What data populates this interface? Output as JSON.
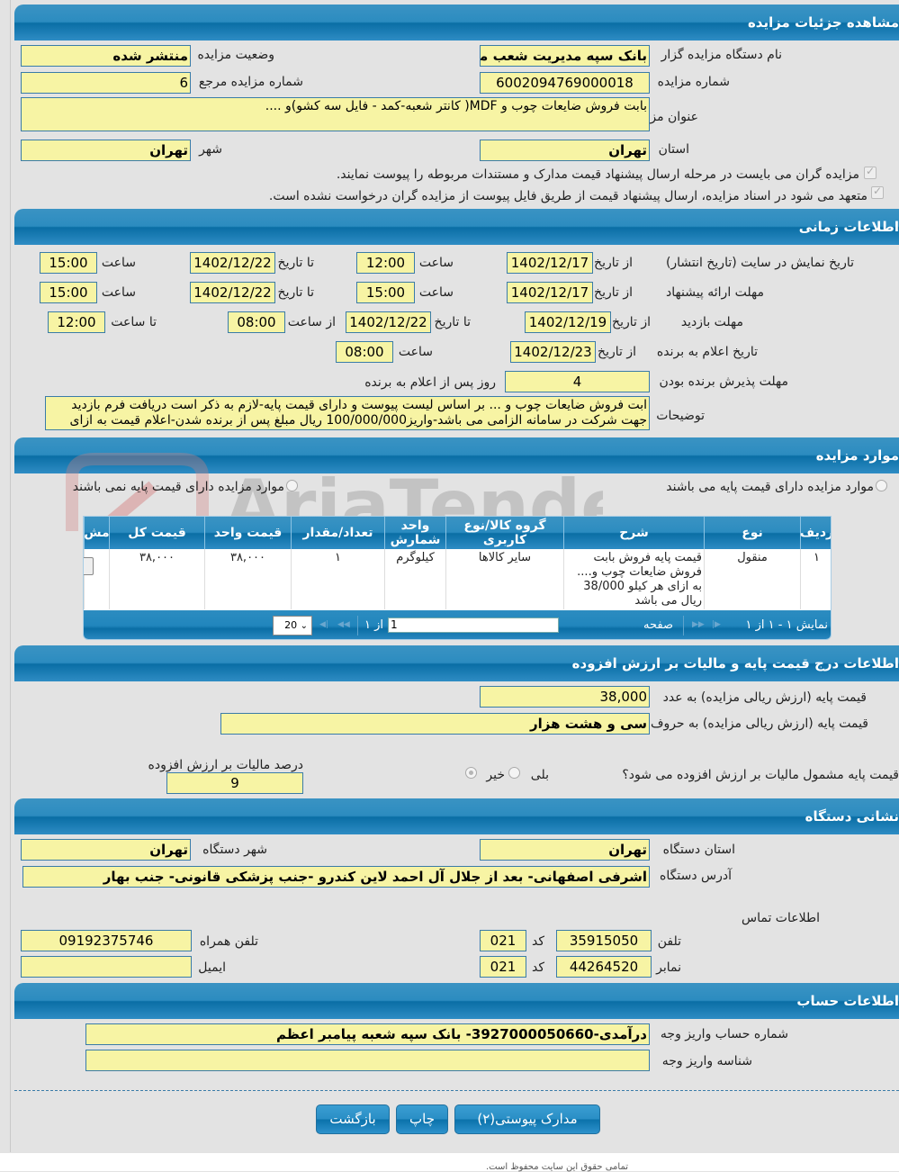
{
  "sections": {
    "details": "مشاهده جزئیات مزایده",
    "timing": "اطلاعات زمانی",
    "items": "موارد مزایده",
    "pricing": "اطلاعات درج قیمت پایه و مالیات بر ارزش افزوده",
    "address": "نشانی دستگاه",
    "account": "اطلاعات حساب"
  },
  "details": {
    "org_label": "نام دستگاه مزایده گزار",
    "org_value": "بانک سپه مدیریت شعب من",
    "status_label": "وضعیت مزایده",
    "status_value": "منتشر شده",
    "number_label": "شماره مزایده",
    "number_value": "6002094769000018",
    "ref_label": "شماره مزایده مرجع",
    "ref_value": "6",
    "title_label": "عنوان مزایده",
    "title_value": "بابت فروش ضایعات چوب و MDF( کانتر شعبه-کمد - فایل سه کشو)و ....",
    "province_label": "استان",
    "province_value": "تهران",
    "city_label": "شهر",
    "city_value": "تهران",
    "check1": "مزایده گران می بایست در مرحله ارسال پیشنهاد قیمت مدارک و مستندات مربوطه را پیوست نمایند.",
    "check2": "متعهد می شود در اسناد مزایده، ارسال پیشنهاد قیمت از طریق فایل پیوست از مزایده گران درخواست نشده است."
  },
  "timing": {
    "from_date": "از تاریخ",
    "to_date": "تا تاریخ",
    "hour": "ساعت",
    "from_hour": "از ساعت",
    "to_hour": "تا ساعت",
    "display_label": "تاریخ نمایش در سایت (تاریخ انتشار)",
    "display_from": "1402/12/17",
    "display_from_time": "12:00",
    "display_to": "1402/12/22",
    "display_to_time": "15:00",
    "offer_label": "مهلت ارائه پیشنهاد",
    "offer_from": "1402/12/17",
    "offer_from_time": "15:00",
    "offer_to": "1402/12/22",
    "offer_to_time": "15:00",
    "visit_label": "مهلت بازدید",
    "visit_from": "1402/12/19",
    "visit_to": "1402/12/22",
    "visit_from_time": "08:00",
    "visit_to_time": "12:00",
    "announce_label": "تاریخ اعلام به برنده",
    "announce_from": "1402/12/23",
    "announce_time": "08:00",
    "accept_label": "مهلت پذیرش برنده بودن",
    "accept_value": "4",
    "accept_suffix": "روز پس از اعلام به برنده",
    "desc_label": "توضیحات",
    "desc_value": "ابت فروش ضایعات چوب و ... بر اساس لیست پیوست و دارای قیمت پایه-لازم به ذکر است دریافت فرم بازدید جهت شرکت در سامانه الزامی می باشد-واریز100/000/000 ریال مبلغ پس از برنده شدن-اعلام قیمت به ازای"
  },
  "items": {
    "radio_with_base": "موارد مزایده دارای قیمت پایه می باشند",
    "radio_without_base": "موارد مزایده دارای قیمت پایه نمی باشند",
    "columns": [
      "ردیف",
      "نوع",
      "شرح",
      "گروه کالا/نوع کاربری",
      "واحد شمارش",
      "تعداد/مقدار",
      "قیمت واحد",
      "قیمت کل",
      "مش"
    ],
    "rows": [
      {
        "row": "۱",
        "type": "منقول",
        "desc": "قیمت پایه فروش بابت فروش ضایعات چوب و.... به ازای هر کیلو 38/000 ریال می باشد",
        "group": "سایر کالاها",
        "unit": "کیلوگرم",
        "qty": "۱",
        "unit_price": "۳۸,۰۰۰",
        "total": "۳۸,۰۰۰"
      }
    ],
    "pager": {
      "summary": "نمایش ۱ - ۱ از ۱",
      "page_label": "صفحه",
      "page_value": "1",
      "of_label": "از ۱",
      "page_size": "20"
    }
  },
  "pricing": {
    "num_label": "قیمت پایه (ارزش ریالی مزایده) به عدد",
    "num_value": "38,000",
    "words_label": "قیمت پایه (ارزش ریالی مزایده) به حروف",
    "words_value": "سی و هشت هزار",
    "vat_question": "قیمت پایه مشمول مالیات بر ارزش افزوده می شود؟",
    "yes": "بلی",
    "no": "خیر",
    "vat_percent_label": "درصد مالیات بر ارزش افزوده",
    "vat_percent_value": "9"
  },
  "address": {
    "province_label": "استان دستگاه",
    "province_value": "تهران",
    "city_label": "شهر دستگاه",
    "city_value": "تهران",
    "address_label": "آدرس دستگاه",
    "address_value": "اشرفی اصفهانی- بعد از جلال آل احمد لاین کندرو -جنب پزشکی قانونی- جنب بهار",
    "contact_label": "اطلاعات تماس",
    "phone_label": "تلفن",
    "phone_value": "35915050",
    "code_label": "کد",
    "phone_code": "021",
    "mobile_label": "تلفن همراه",
    "mobile_value": "09192375746",
    "fax_label": "نمابر",
    "fax_value": "44264520",
    "fax_code": "021",
    "email_label": "ایمیل",
    "email_value": ""
  },
  "account": {
    "acc_label": "شماره حساب واریز وجه",
    "acc_value": "درآمدی-3927000050660- بانک سپه شعبه پیامبر اعظم",
    "id_label": "شناسه واریز وجه",
    "id_value": ""
  },
  "buttons": {
    "attachments": "مدارک پیوستی(۲)",
    "print": "چاپ",
    "back": "بازگشت"
  },
  "footer": "تمامی حقوق این سایت محفوظ است.",
  "watermark": "AriaTender.neT"
}
